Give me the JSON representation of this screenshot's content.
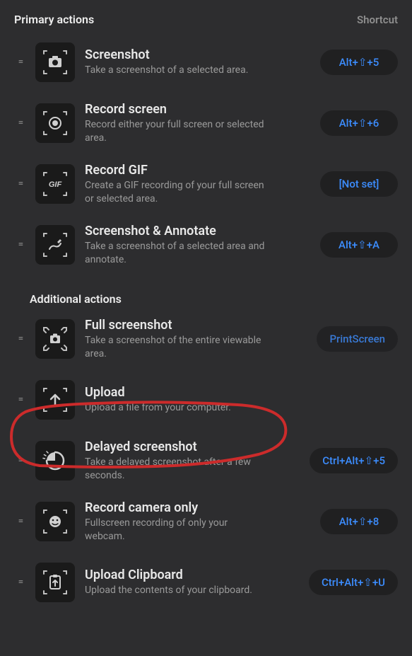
{
  "header": {
    "primary_label": "Primary actions",
    "shortcut_label": "Shortcut",
    "additional_label": "Additional actions"
  },
  "primary": [
    {
      "icon": "camera-icon",
      "title": "Screenshot",
      "desc": "Take a screenshot of a selected area.",
      "shortcut": "Alt+⇧+5"
    },
    {
      "icon": "record-screen-icon",
      "title": "Record screen",
      "desc": "Record either your full screen or selected area.",
      "shortcut": "Alt+⇧+6"
    },
    {
      "icon": "gif-icon",
      "title": "Record GIF",
      "desc": "Create a GIF recording of your full screen or selected area.",
      "shortcut": "[Not set]"
    },
    {
      "icon": "annotate-icon",
      "title": "Screenshot & Annotate",
      "desc": "Take a screenshot of a selected area and annotate.",
      "shortcut": "Alt+⇧+A"
    }
  ],
  "additional": [
    {
      "icon": "full-screenshot-icon",
      "title": "Full screenshot",
      "desc": "Take a screenshot of the entire viewable area.",
      "shortcut": "PrintScreen",
      "dim": true
    },
    {
      "icon": "upload-icon",
      "title": "Upload",
      "desc": "Upload a file from your computer.",
      "shortcut": "",
      "highlighted": true
    },
    {
      "icon": "delayed-icon",
      "title": "Delayed screenshot",
      "desc": "Take a delayed screenshot after a few seconds.",
      "shortcut": "Ctrl+Alt+⇧+5"
    },
    {
      "icon": "camera-only-icon",
      "title": "Record camera only",
      "desc": "Fullscreen recording of only your webcam.",
      "shortcut": "Alt+⇧+8"
    },
    {
      "icon": "upload-clipboard-icon",
      "title": "Upload Clipboard",
      "desc": "Upload the contents of your clipboard.",
      "shortcut": "Ctrl+Alt+⇧+U"
    }
  ],
  "ui": {
    "drag_glyph": "=",
    "gif_text": "GIF"
  },
  "colors": {
    "accent": "#3c8dff",
    "bg": "#2d2d2f",
    "icon_bg": "#1a1a1a",
    "annotation": "#cc2b2b"
  }
}
